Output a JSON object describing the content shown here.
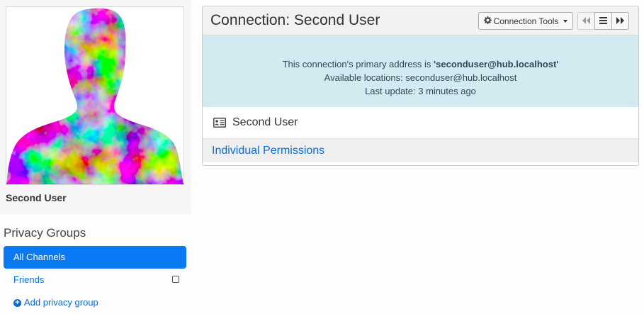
{
  "profile": {
    "name": "Second User",
    "photo_alt": "avatar"
  },
  "privacy_groups": {
    "title": "Privacy Groups",
    "items": [
      {
        "label": "All Channels",
        "active": true
      },
      {
        "label": "Friends",
        "active": false
      }
    ],
    "add_label": "Add privacy group"
  },
  "connection": {
    "title": "Connection: Second User",
    "tools_label": "Connection Tools",
    "info": {
      "primary_prefix": "This connection's primary address is ",
      "primary_address": "'seconduser@hub.localhost'",
      "locations": "Available locations: seconduser@hub.localhost",
      "last_update": "Last update: 3 minutes ago"
    },
    "display_name": "Second User",
    "permissions_label": "Individual Permissions"
  },
  "colors": {
    "accent": "#0b78f4",
    "info_background": "#d3eaf0",
    "link": "#0a6cd6"
  },
  "icons": {
    "tools": "gear-icon",
    "first": "double-left-icon",
    "list": "list-icon",
    "next": "double-right-icon",
    "card": "vcard-icon",
    "add": "plus-circle-icon"
  }
}
